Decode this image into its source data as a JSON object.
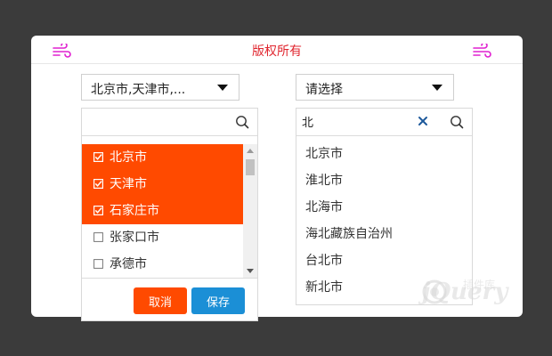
{
  "header": {
    "title": "版权所有",
    "title_color": "#e0262f",
    "icon": "wind-icon",
    "icon_color": "#e020d0"
  },
  "left_select": {
    "selected_value": "北京市,天津市,...",
    "search_placeholder": "",
    "items": [
      {
        "label": "北京市",
        "checked": true
      },
      {
        "label": "天津市",
        "checked": true
      },
      {
        "label": "石家庄市",
        "checked": true
      },
      {
        "label": "张家口市",
        "checked": false
      },
      {
        "label": "承德市",
        "checked": false
      }
    ],
    "cancel_label": "取消",
    "save_label": "保存",
    "checked_color": "#ff4a00",
    "save_color": "#1b8fd6"
  },
  "right_select": {
    "selected_value": "请选择",
    "search_value": "北",
    "items": [
      "北京市",
      "淮北市",
      "北海市",
      "海北藏族自治州",
      "台北市",
      "新北市"
    ]
  },
  "watermark": {
    "text": "jQuery",
    "subtext": "插件库"
  }
}
